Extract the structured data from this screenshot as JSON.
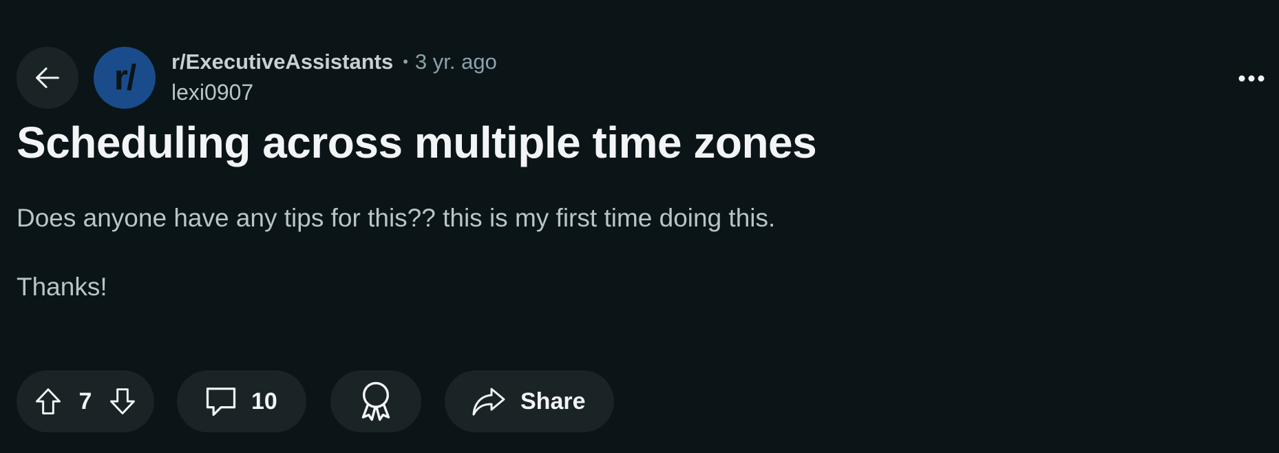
{
  "post": {
    "subreddit": "r/ExecutiveAssistants",
    "separator": "•",
    "time_ago": "3 yr. ago",
    "author": "lexi0907",
    "avatar_text": "r/",
    "title": "Scheduling across multiple time zones",
    "body": [
      "Does anyone have any tips for this?? this is my first time doing this.",
      "Thanks!"
    ]
  },
  "actions": {
    "vote_count": "7",
    "comment_count": "10",
    "share_label": "Share"
  },
  "icons": {
    "back": "arrow-left-icon",
    "more": "more-horizontal-icon",
    "upvote": "arrow-up-icon",
    "downvote": "arrow-down-icon",
    "comment": "comment-bubble-icon",
    "award": "award-icon",
    "share": "share-arrow-icon"
  },
  "colors": {
    "background": "#0b1416",
    "button_bg": "#1a2427",
    "avatar_bg": "#1a4c8c"
  }
}
